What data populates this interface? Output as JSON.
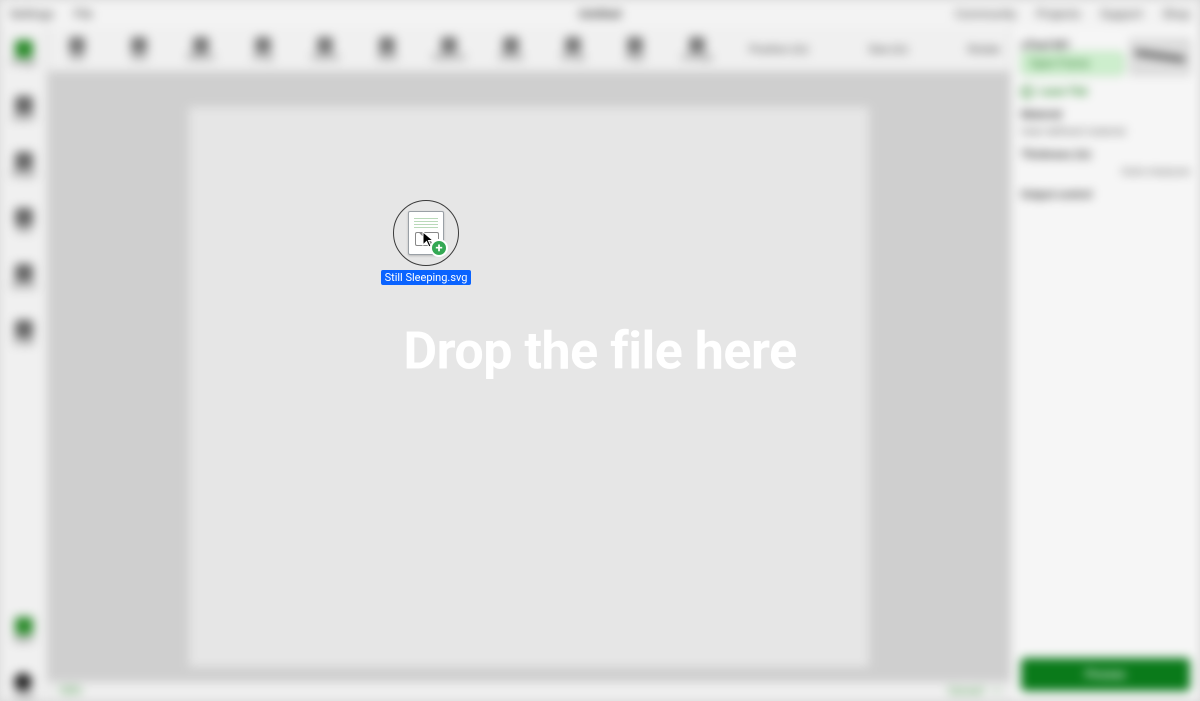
{
  "topbar": {
    "menu_left": [
      "Settings",
      "File"
    ],
    "title": "Untitled",
    "menu_right": [
      "Community",
      "Projects",
      "Support",
      "Shop"
    ]
  },
  "left_tools": [
    {
      "label": "Image"
    },
    {
      "label": "Insert"
    },
    {
      "label": "Shape"
    },
    {
      "label": "Text"
    },
    {
      "label": "Vector"
    },
    {
      "label": "Code"
    }
  ],
  "left_tools_bottom": [
    {
      "label": "Apps"
    },
    {
      "label": "Trash"
    }
  ],
  "toolbar": {
    "items": [
      "Edit",
      "Size",
      "Reflect",
      "Array",
      "Outline",
      "Weld",
      "Subtract",
      "Offset",
      "Group",
      "Align",
      "Arrange"
    ],
    "position_label": "Position (in)",
    "size_label": "Size (in)",
    "rotate_label": "Rotate"
  },
  "right_panel": {
    "device": "xTool M1",
    "frame_btn": "Open Frame",
    "laser_flat": "Laser Flat",
    "material_label": "Material",
    "material_value": "User-defined material",
    "thickness_label": "Thickness (in)",
    "auto_measure": "Auto-measure",
    "output_label": "Output control",
    "process_btn": "Process"
  },
  "bottom": {
    "canvas_label": "Canvas1",
    "zoom": "100%"
  },
  "overlay": {
    "drop_text": "Drop the file here",
    "dragged_file_name": "Still Sleeping.svg"
  },
  "icons": {
    "plus": "+"
  }
}
